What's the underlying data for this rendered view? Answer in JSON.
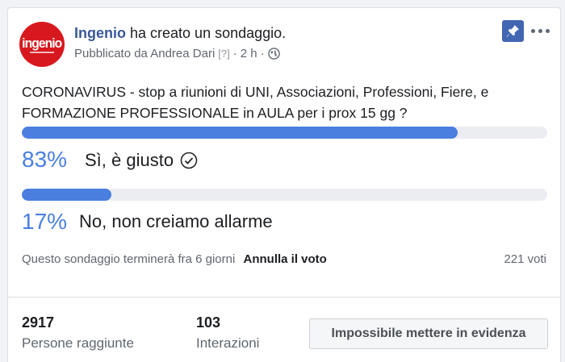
{
  "post": {
    "page_name": "Ingenio",
    "action_text": " ha creato un sondaggio.",
    "published_by": "Pubblicato da Andrea Dari",
    "bracket_note": "[?]",
    "separator": "·",
    "time_ago": "2 h",
    "separator2": "·",
    "avatar_logo": "ingenio",
    "icons": {
      "pin": "pin-icon",
      "more": "more-options-icon",
      "globe": "globe-icon",
      "check": "check-circle-icon"
    },
    "colors": {
      "accent": "#4a7fe0",
      "link": "#385898",
      "pin_bg": "#4267b2",
      "avatar_bg": "#d7191f"
    }
  },
  "poll": {
    "question": "CORONAVIRUS - stop a riunioni di UNI, Associazioni, Professioni, Fiere, e FORMAZIONE PROFESSIONALE in AULA per i prox 15 gg ?",
    "options": [
      {
        "percent_text": "83%",
        "percent": 83,
        "label": "Sì, è giusto",
        "selected": true
      },
      {
        "percent_text": "17%",
        "percent": 17,
        "label": "No, non creiamo allarme",
        "selected": false
      }
    ],
    "ends_text": "Questo sondaggio terminerà fra 6 giorni",
    "undo_label": "Annulla il voto",
    "votes_text": "221 voti"
  },
  "insights": {
    "reach_value": "2917",
    "reach_label": "Persone raggiunte",
    "interactions_value": "103",
    "interactions_label": "Interazioni",
    "boost_label": "Impossibile mettere in evidenza"
  }
}
